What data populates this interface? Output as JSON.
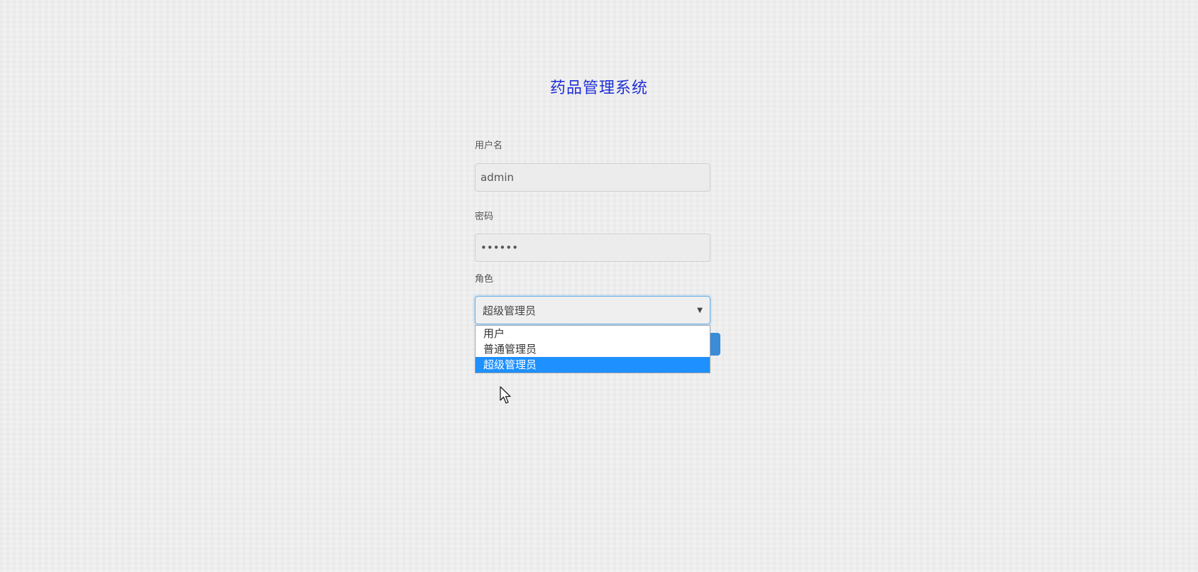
{
  "page": {
    "title": "药品管理系统",
    "title_color": "#1f2fd8",
    "background_color": "#eeeeee"
  },
  "form": {
    "username_label": "用户名",
    "username_value": "admin",
    "password_label": "密码",
    "password_value": "••••••",
    "role_label": "角色",
    "role_selected": "超级管理员",
    "role_dropdown_icon": "triangle-down-icon",
    "role_options": [
      {
        "label": "用户"
      },
      {
        "label": "普通管理员"
      },
      {
        "label": "超级管理员",
        "selected": true
      }
    ],
    "submit_label": "",
    "submit_color": "#3c8bd6"
  },
  "highlight_color": "#1e90ff",
  "cursor": {
    "icon": "mouse-pointer-icon"
  }
}
